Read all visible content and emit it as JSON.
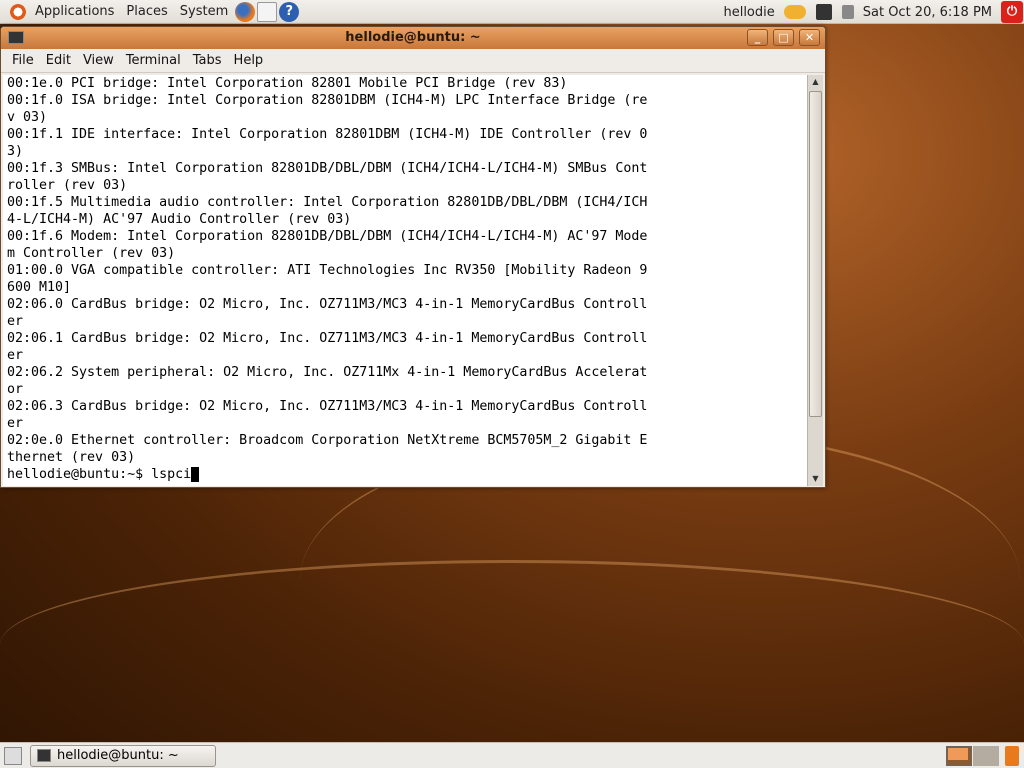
{
  "top_panel": {
    "menus": [
      "Applications",
      "Places",
      "System"
    ],
    "user": "hellodie",
    "clock": "Sat Oct 20,  6:18 PM"
  },
  "window": {
    "title": "hellodie@buntu: ~",
    "menu": [
      "File",
      "Edit",
      "View",
      "Terminal",
      "Tabs",
      "Help"
    ],
    "lines": [
      "00:1e.0 PCI bridge: Intel Corporation 82801 Mobile PCI Bridge (rev 83)",
      "00:1f.0 ISA bridge: Intel Corporation 82801DBM (ICH4-M) LPC Interface Bridge (re",
      "v 03)",
      "00:1f.1 IDE interface: Intel Corporation 82801DBM (ICH4-M) IDE Controller (rev 0",
      "3)",
      "00:1f.3 SMBus: Intel Corporation 82801DB/DBL/DBM (ICH4/ICH4-L/ICH4-M) SMBus Cont",
      "roller (rev 03)",
      "00:1f.5 Multimedia audio controller: Intel Corporation 82801DB/DBL/DBM (ICH4/ICH",
      "4-L/ICH4-M) AC'97 Audio Controller (rev 03)",
      "00:1f.6 Modem: Intel Corporation 82801DB/DBL/DBM (ICH4/ICH4-L/ICH4-M) AC'97 Mode",
      "m Controller (rev 03)",
      "01:00.0 VGA compatible controller: ATI Technologies Inc RV350 [Mobility Radeon 9",
      "600 M10]",
      "02:06.0 CardBus bridge: O2 Micro, Inc. OZ711M3/MC3 4-in-1 MemoryCardBus Controll",
      "er",
      "02:06.1 CardBus bridge: O2 Micro, Inc. OZ711M3/MC3 4-in-1 MemoryCardBus Controll",
      "er",
      "02:06.2 System peripheral: O2 Micro, Inc. OZ711Mx 4-in-1 MemoryCardBus Accelerat",
      "or",
      "02:06.3 CardBus bridge: O2 Micro, Inc. OZ711M3/MC3 4-in-1 MemoryCardBus Controll",
      "er",
      "02:0e.0 Ethernet controller: Broadcom Corporation NetXtreme BCM5705M_2 Gigabit E",
      "thernet (rev 03)"
    ],
    "prompt": "hellodie@buntu:~$ lspci"
  },
  "bottom_panel": {
    "task": "hellodie@buntu: ~"
  }
}
